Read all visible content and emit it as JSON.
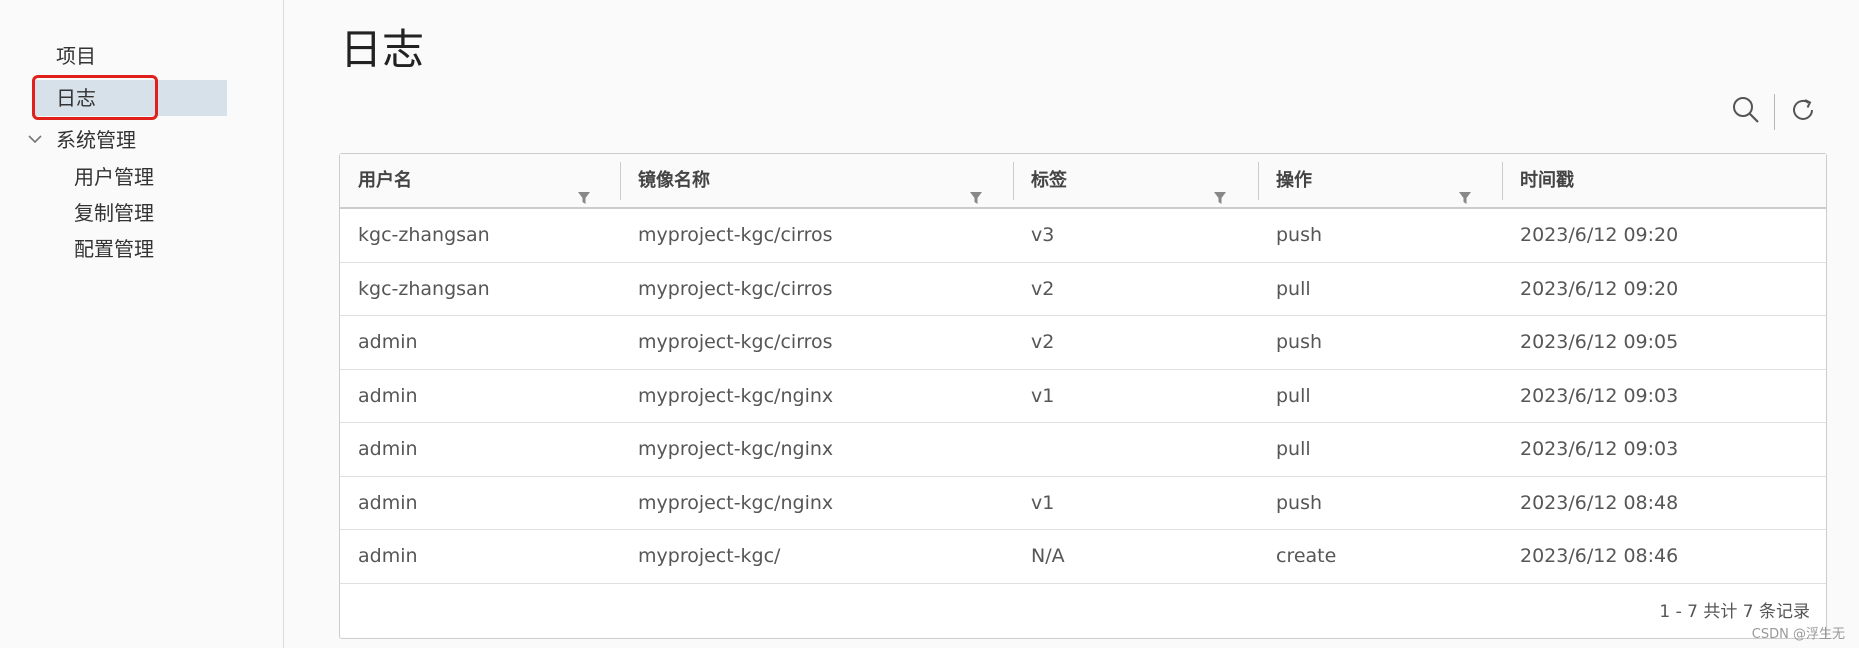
{
  "sidebar": {
    "projects": "项目",
    "logs": "日志",
    "system": {
      "label": "系统管理",
      "chevron_icon": "chevron-down-icon",
      "items": [
        {
          "label": "用户管理"
        },
        {
          "label": "复制管理"
        },
        {
          "label": "配置管理"
        }
      ]
    },
    "highlight_color": "#e0201a",
    "active_bg": "#d7e1e9"
  },
  "page": {
    "title": "日志"
  },
  "toolbar": {
    "search_icon": "search-icon",
    "refresh_icon": "refresh-icon"
  },
  "table": {
    "columns": [
      {
        "label": "用户名",
        "filter": true
      },
      {
        "label": "镜像名称",
        "filter": true
      },
      {
        "label": "标签",
        "filter": true
      },
      {
        "label": "操作",
        "filter": true
      },
      {
        "label": "时间戳",
        "filter": false
      }
    ],
    "rows": [
      [
        "kgc-zhangsan",
        "myproject-kgc/cirros",
        "v3",
        "push",
        "2023/6/12 09:20"
      ],
      [
        "kgc-zhangsan",
        "myproject-kgc/cirros",
        "v2",
        "pull",
        "2023/6/12 09:20"
      ],
      [
        "admin",
        "myproject-kgc/cirros",
        "v2",
        "push",
        "2023/6/12 09:05"
      ],
      [
        "admin",
        "myproject-kgc/nginx",
        "v1",
        "pull",
        "2023/6/12 09:03"
      ],
      [
        "admin",
        "myproject-kgc/nginx",
        "",
        "pull",
        "2023/6/12 09:03"
      ],
      [
        "admin",
        "myproject-kgc/nginx",
        "v1",
        "push",
        "2023/6/12 08:48"
      ],
      [
        "admin",
        "myproject-kgc/",
        "N/A",
        "create",
        "2023/6/12 08:46"
      ]
    ],
    "footer": "1 - 7 共计 7 条记录"
  },
  "watermark": "CSDN @浮生无"
}
